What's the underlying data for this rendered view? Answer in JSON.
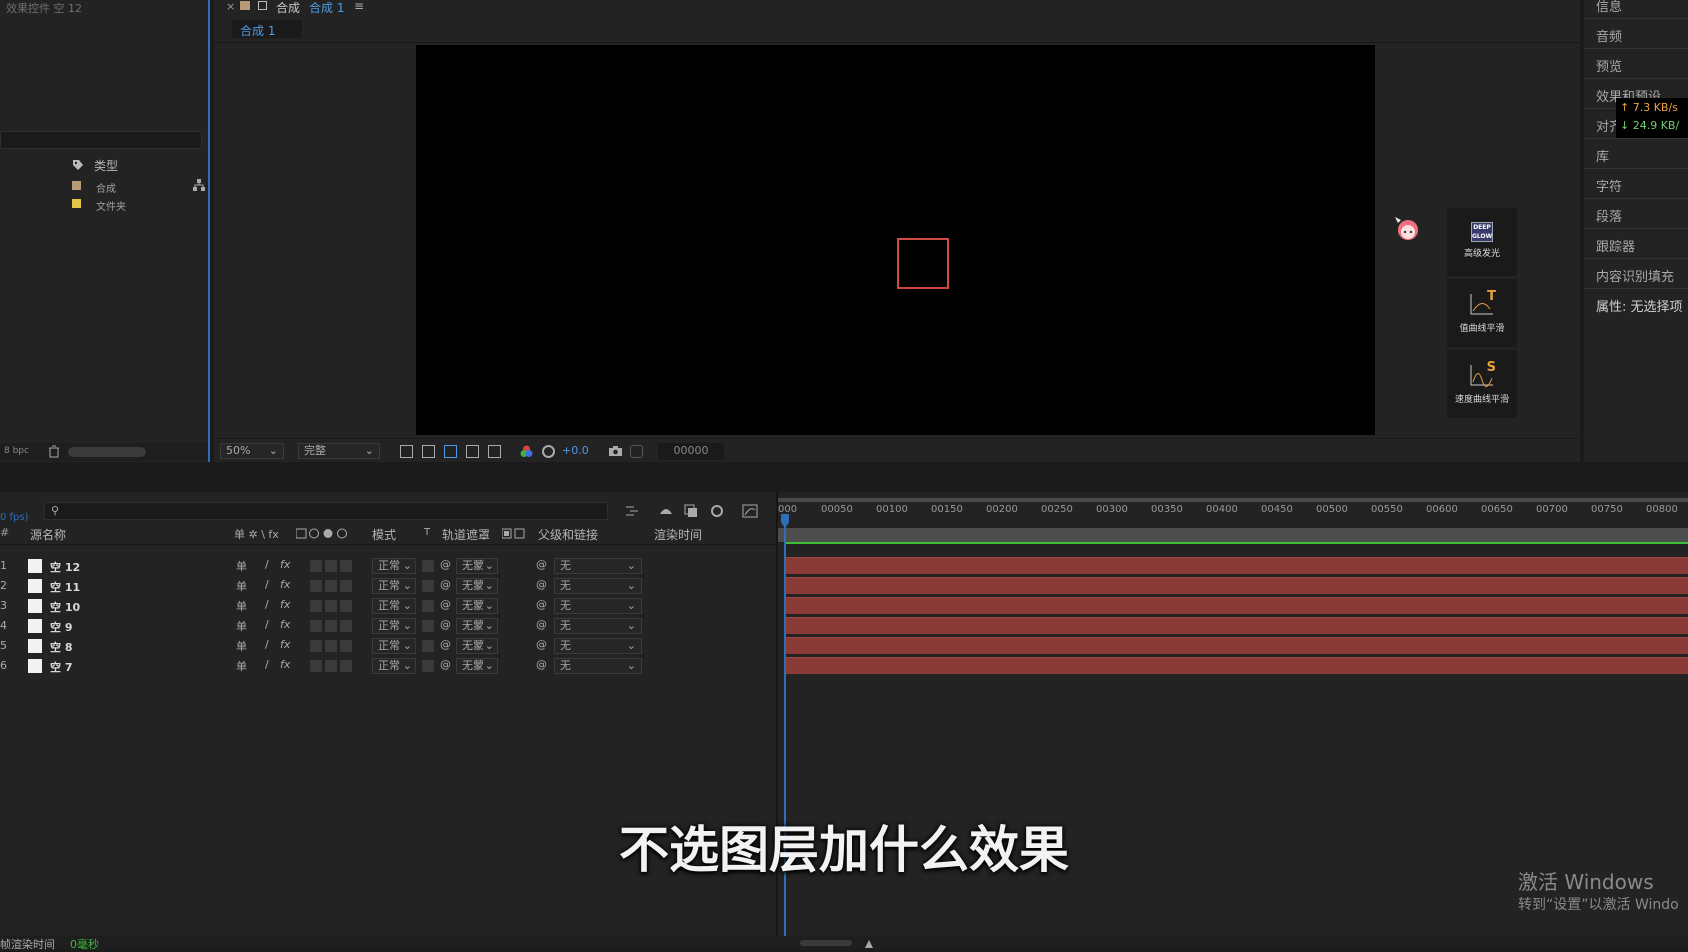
{
  "left_panel": {
    "title": "效果控件 空 12",
    "column_type": "类型",
    "items": [
      {
        "label": "合成",
        "color": "#b89a76"
      },
      {
        "label": "文件夹",
        "color": "#e2c54a"
      }
    ],
    "bpc": "8 bpc"
  },
  "comp_panel": {
    "tab_close": "×",
    "tab_label_prefix": "合成",
    "tab_label_name": "合成 1",
    "tab_menu": "≡",
    "subtab": "合成 1",
    "zoom": "50%",
    "quality": "完整",
    "exposure": "+0.0",
    "timecode": "00000"
  },
  "plugins": [
    {
      "label": "高级发光",
      "icon_text": "DEEP GLOW"
    },
    {
      "label": "值曲线平滑",
      "icon_text": "T"
    },
    {
      "label": "速度曲线平滑",
      "icon_text": "S"
    }
  ],
  "right_panel": {
    "items": [
      "信息",
      "音频",
      "预览",
      "效果和预设",
      "对齐",
      "库",
      "字符",
      "段落",
      "跟踪器",
      "内容识别填充",
      "属性: 无选择项"
    ]
  },
  "network": {
    "up": "↑ 7.3 KB/s",
    "down": "↓ 24.9 KB/"
  },
  "timeline": {
    "fps": "0 fps)",
    "search_placeholder": "",
    "headers": {
      "num": "#",
      "source": "源名称",
      "switches": "单 ✲ \\ fx",
      "mode": "模式",
      "t": "T",
      "track_matte": "轨道遮罩",
      "parent": "父级和链接",
      "render_time": "渲染时间"
    },
    "layers": [
      {
        "num": "1",
        "name": "空 12",
        "mode": "正常",
        "matte": "无蒙",
        "parent": "无"
      },
      {
        "num": "2",
        "name": "空 11",
        "mode": "正常",
        "matte": "无蒙",
        "parent": "无"
      },
      {
        "num": "3",
        "name": "空 10",
        "mode": "正常",
        "matte": "无蒙",
        "parent": "无"
      },
      {
        "num": "4",
        "name": "空 9",
        "mode": "正常",
        "matte": "无蒙",
        "parent": "无"
      },
      {
        "num": "5",
        "name": "空 8",
        "mode": "正常",
        "matte": "无蒙",
        "parent": "无"
      },
      {
        "num": "6",
        "name": "空 7",
        "mode": "正常",
        "matte": "无蒙",
        "parent": "无"
      }
    ],
    "ruler": [
      "000",
      "00050",
      "00100",
      "00150",
      "00200",
      "00250",
      "00300",
      "00350",
      "00400",
      "00450",
      "00500",
      "00550",
      "00600",
      "00650",
      "00700",
      "00750",
      "00800"
    ],
    "footer_label": "帧渲染时间",
    "footer_value": "0毫秒"
  },
  "subtitle": "不选图层加什么效果",
  "watermark": {
    "line1": "激活 Windows",
    "line2": "转到“设置”以激活 Windo"
  },
  "colors": {
    "accent": "#2d6fb8",
    "layer_bar": "#8a3b37",
    "green_line": "#3bbf3b"
  }
}
